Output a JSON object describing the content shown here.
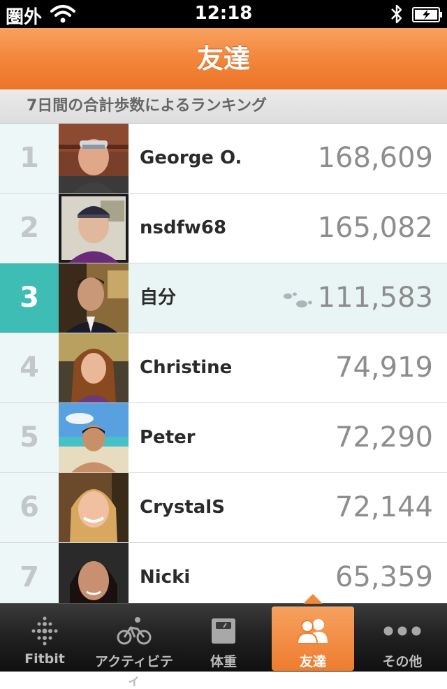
{
  "status_bar": {
    "carrier": "圏外",
    "time": "12:18"
  },
  "nav": {
    "title": "友達"
  },
  "section": {
    "header": "7日間の合計歩数によるランキング"
  },
  "ranking": [
    {
      "rank": "1",
      "name": "George O.",
      "steps": "168,609"
    },
    {
      "rank": "2",
      "name": "nsdfw68",
      "steps": "165,082"
    },
    {
      "rank": "3",
      "name": "自分",
      "steps": "111,583"
    },
    {
      "rank": "4",
      "name": "Christine",
      "steps": "74,919"
    },
    {
      "rank": "5",
      "name": "Peter",
      "steps": "72,290"
    },
    {
      "rank": "6",
      "name": "CrystalS",
      "steps": "72,144"
    },
    {
      "rank": "7",
      "name": "Nicki",
      "steps": "65,359"
    }
  ],
  "tabs": [
    {
      "label": "Fitbit",
      "icon": "fitbit-dots-icon"
    },
    {
      "label": "アクティビティ",
      "icon": "bicycle-icon"
    },
    {
      "label": "体重",
      "icon": "scale-icon"
    },
    {
      "label": "友達",
      "icon": "friends-icon"
    },
    {
      "label": "その他",
      "icon": "more-dots-icon"
    }
  ],
  "colors": {
    "accent_orange": "#f28438",
    "self_highlight": "#3dbdb3",
    "rank_bg": "#eef7f7"
  }
}
